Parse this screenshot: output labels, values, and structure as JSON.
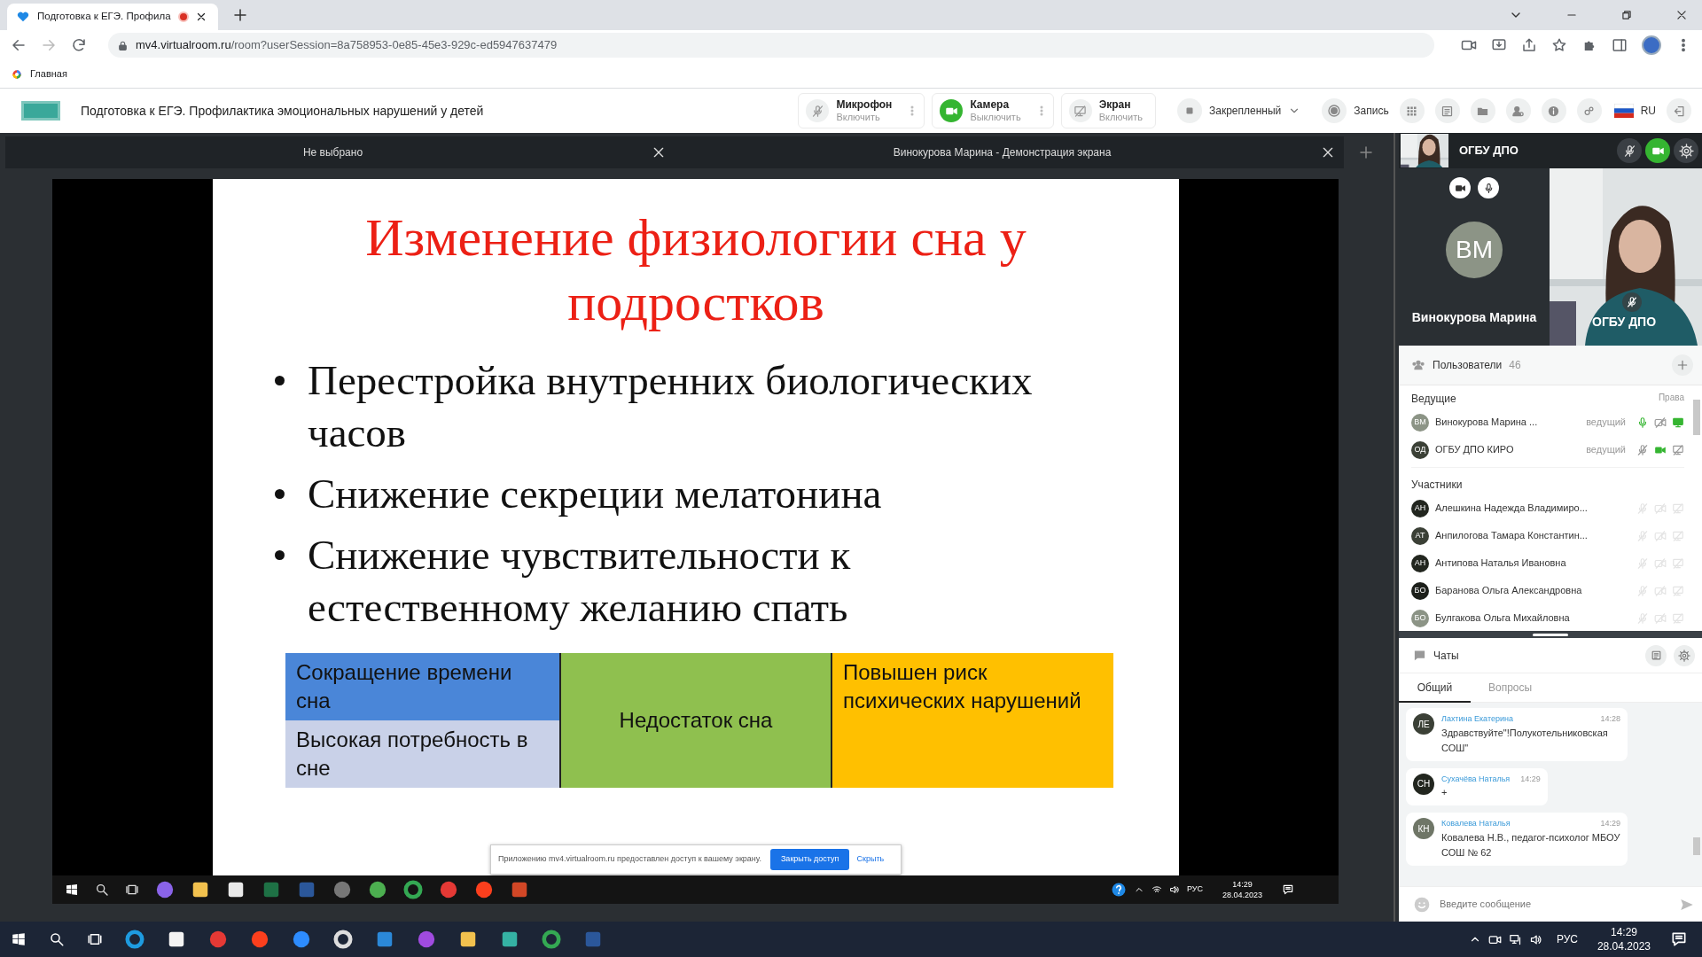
{
  "browser": {
    "tab_title": "Подготовка к ЕГЭ. Профила",
    "url_host": "mv4.virtualroom.ru",
    "url_path": "/room?userSession=8a758953-0e85-45e3-929c-ed5947637479",
    "bookmark": "Главная"
  },
  "app": {
    "title": "Подготовка к ЕГЭ. Профилактика эмоциональных нарушений у детей",
    "controls": [
      {
        "kind": "mic",
        "label": "Микрофон",
        "action": "Включить",
        "on": false
      },
      {
        "kind": "camera",
        "label": "Камера",
        "action": "Выключить",
        "on": true
      },
      {
        "kind": "screen",
        "label": "Экран",
        "action": "Включить",
        "on": false
      }
    ],
    "layout": "Закрепленный",
    "record": "Запись",
    "language": "RU"
  },
  "screen_tabs": [
    {
      "label": "Не выбрано"
    },
    {
      "label": "Винокурова Марина - Демонстрация экрана"
    }
  ],
  "slide": {
    "title": "Изменение физиологии сна у подростков",
    "bullets": [
      "Перестройка внутренних биологических часов",
      "Снижение секреции мелатонина",
      "Снижение чувствительности к естественному желанию спать"
    ],
    "table": {
      "left_top": "Сокращение времени сна",
      "left_bottom": "Высокая потребность в сне",
      "middle": "Недостаток сна",
      "right": "Повышен риск психических нарушений"
    }
  },
  "share_notice": {
    "text": "Приложению mv4.virtualroom.ru предоставлен доступ к вашему экрану.",
    "button": "Закрыть доступ",
    "link": "Скрыть"
  },
  "shared_taskbar": {
    "language": "РУС",
    "time": "14:29",
    "date": "28.04.2023"
  },
  "panel": {
    "self_name": "ОГБУ ДПО",
    "self_mic_on": false,
    "self_camera_on": true,
    "tiles": [
      {
        "kind": "avatar",
        "initials": "ВМ",
        "name": "Винокурова Марина"
      },
      {
        "kind": "video",
        "name": "ОГБУ ДПО"
      }
    ],
    "users": {
      "title": "Пользователи",
      "count": "46",
      "hosts_heading": "Ведущие",
      "rights": "Права",
      "hosts": [
        {
          "initials": "ВМ",
          "name": "Винокурова Марина ...",
          "role": "ведущий",
          "color": "#8c9486",
          "mic_on": true,
          "camera_on": false,
          "screen_on": true
        },
        {
          "initials": "ОД",
          "name": "ОГБУ ДПО КИРО",
          "role": "ведущий",
          "color": "#3b4036",
          "mic_on": false,
          "camera_on": true,
          "screen_on": false
        }
      ],
      "participants_heading": "Участники",
      "participants": [
        {
          "initials": "АН",
          "name": "Алешкина Надежда Владимиро...",
          "color": "#22261f"
        },
        {
          "initials": "АТ",
          "name": "Анпилогова Тамара Константин...",
          "color": "#3b4036"
        },
        {
          "initials": "АН",
          "name": "Антипова Наталья Ивановна",
          "color": "#22261f"
        },
        {
          "initials": "БО",
          "name": "Баранова Ольга Александровна",
          "color": "#1c1f1a"
        },
        {
          "initials": "БО",
          "name": "Булгакова Ольга Михайловна",
          "color": "#8c9486"
        }
      ]
    }
  },
  "chat": {
    "title": "Чаты",
    "tabs": [
      {
        "label": "Общий",
        "selected": true
      },
      {
        "label": "Вопросы",
        "selected": false
      }
    ],
    "messages": [
      {
        "initials": "ЛЕ",
        "author": "Лахтина Екатерина",
        "time": "14:28",
        "text": "Здравствуйте\"!Полукотельниковская СОШ\"",
        "color": "#3b4036"
      },
      {
        "initials": "СН",
        "author": "Сухачёва Наталья",
        "time": "14:29",
        "text": "+",
        "color": "#22261f"
      },
      {
        "initials": "КН",
        "author": "Ковалева Наталья",
        "time": "14:29",
        "text": "Ковалева Н.В., педагог-психолог МБОУ СОШ № 62",
        "color": "#6f7667"
      }
    ],
    "placeholder": "Введите сообщение"
  },
  "taskbar": {
    "language": "РУС",
    "time": "14:29",
    "date": "28.04.2023"
  }
}
